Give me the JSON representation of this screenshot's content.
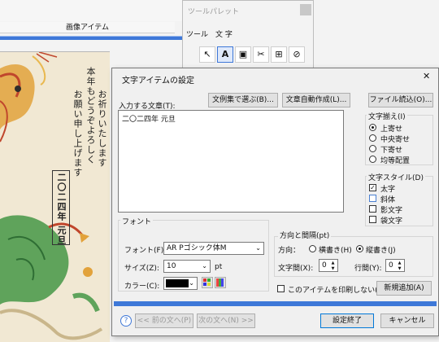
{
  "background": {
    "image_item_title": "画像アイテム",
    "card_lines": [
      "お祈りいたします",
      "本年もどうぞよろしく",
      "お願い申し上げます"
    ],
    "card_newyear": "二〇二四年 元旦"
  },
  "palette": {
    "title": "ツールパレット",
    "tabs": [
      "ツール",
      "文 字"
    ],
    "tools": [
      "↖",
      "A",
      "▣",
      "✂",
      "⊞",
      "⊘"
    ]
  },
  "dialog": {
    "title": "文字アイテムの設定",
    "close": "✕",
    "input_label": "入力する文章(T):",
    "btn_examples": "文例集で選ぶ(B)...",
    "btn_auto": "文章自動作成(L)...",
    "btn_file": "ファイル読込(O)...",
    "text_value": "二〇二四年 元旦",
    "align": {
      "label": "文字揃え(I)",
      "options": [
        "上寄せ",
        "中央寄せ",
        "下寄せ",
        "均等配置"
      ],
      "selected": "上寄せ"
    },
    "style": {
      "label": "文字スタイル(D)",
      "options": [
        "太字",
        "斜体",
        "影文字",
        "袋文字"
      ],
      "checked": [
        "太字"
      ]
    },
    "font": {
      "group": "フォント",
      "font_label": "フォント(F):",
      "font_value": "AR Pゴシック体M",
      "size_label": "サイズ(Z):",
      "size_value": "10",
      "size_unit": "pt",
      "color_label": "カラー(C):",
      "color_value": "#000000"
    },
    "direction": {
      "group": "方向と間隔(pt)",
      "dir_label": "方向：",
      "horizontal": "横書き(H)",
      "vertical": "縦書き(J)",
      "selected": "縦書き",
      "char_spacing_label": "文字間(X):",
      "char_spacing_value": "0",
      "line_spacing_label": "行間(Y):",
      "line_spacing_value": "0"
    },
    "no_print": "このアイテムを印刷しない(",
    "btn_add_new": "新規追加(A)",
    "btn_prev": "<< 前の文へ(P)",
    "btn_next": "次の文へ(N) >>",
    "btn_done": "設定終了",
    "btn_cancel": "キャンセル",
    "help": "?"
  },
  "colors": {
    "accent_blue": "#3e78d8",
    "card_background": "#f1e8d3"
  }
}
